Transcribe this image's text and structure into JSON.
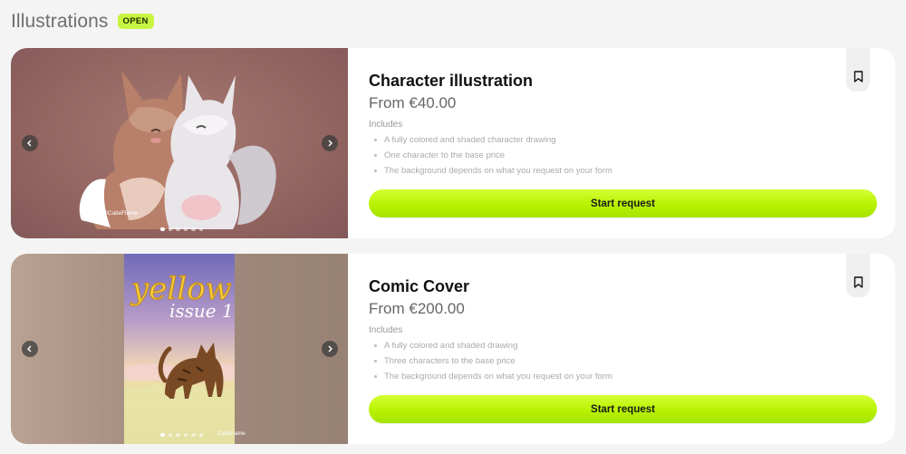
{
  "header": {
    "title": "Illustrations",
    "badge": "OPEN"
  },
  "cards": [
    {
      "title": "Character illustration",
      "price": "From €40.00",
      "includes_label": "Includes",
      "includes": [
        "A fully colored and shaded character drawing",
        "One character to the base price",
        "The background depends on what you request on your form"
      ],
      "button_label": "Start request",
      "artwork_signature": "©CatieFlame",
      "gallery": {
        "slide_count": 6,
        "active_slide": 1
      }
    },
    {
      "title": "Comic Cover",
      "price": "From €200.00",
      "includes_label": "Includes",
      "includes": [
        "A fully colored and shaded drawing",
        "Three characters to the base price",
        "The background depends on what you request on your form"
      ],
      "button_label": "Start request",
      "artwork_title": "yellow",
      "artwork_subtitle": "issue 1",
      "artwork_signature": "CatieFlame",
      "gallery": {
        "slide_count": 6,
        "active_slide": 1
      }
    }
  ],
  "icons": {
    "prev": "chevron-left-icon",
    "next": "chevron-right-icon",
    "bookmark": "bookmark-icon"
  },
  "colors": {
    "accent": "#b8f200",
    "badge": "#c8f542",
    "page_bg": "#f4f4f4"
  }
}
